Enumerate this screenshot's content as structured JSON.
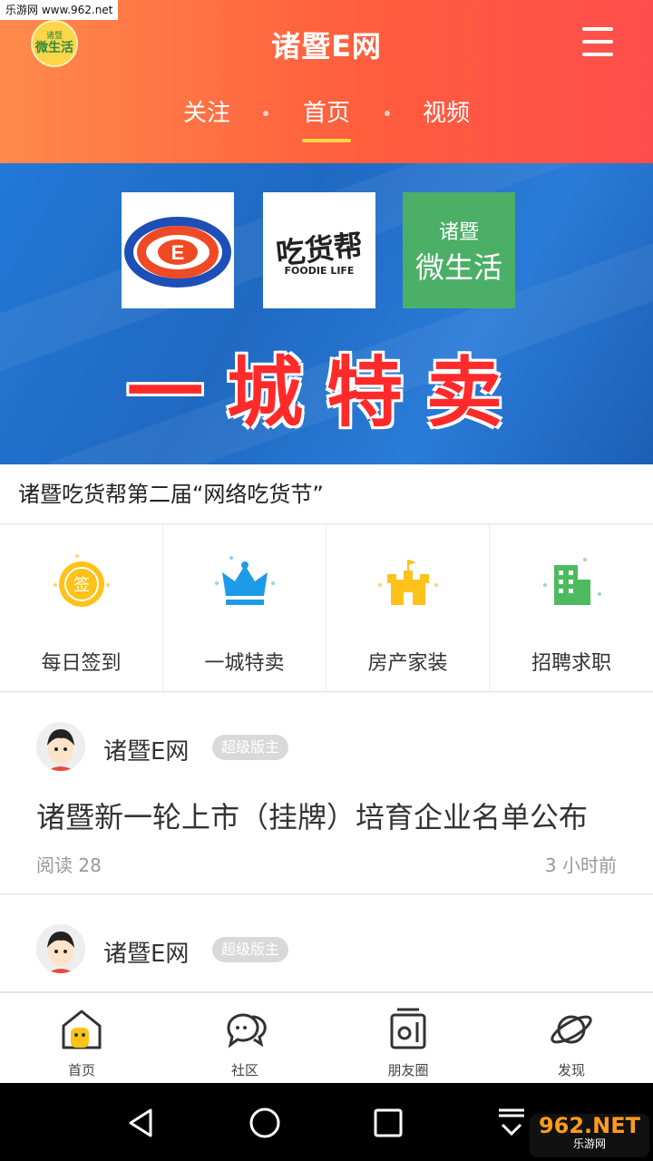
{
  "watermark_top": "乐游网 www.962.net",
  "header": {
    "logo_top": "诸暨",
    "logo_main": "微生活",
    "title": "诸暨E网",
    "tabs": [
      {
        "label": "关注",
        "active": false
      },
      {
        "label": "首页",
        "active": true
      },
      {
        "label": "视频",
        "active": false
      }
    ]
  },
  "banner": {
    "logos": [
      {
        "name": "e-net-logo"
      },
      {
        "name": "foodie-logo",
        "text": "吃货帮",
        "sub": "FOODIE LIFE"
      },
      {
        "name": "wei-life-logo",
        "text_top": "诸暨",
        "text_main": "微生活"
      }
    ],
    "headline": "一城特卖",
    "caption": "诸暨吃货帮第二届“网络吃货节”"
  },
  "quick_links": [
    {
      "label": "每日签到",
      "icon": "sign-in-coin-icon",
      "icon_text": "签"
    },
    {
      "label": "一城特卖",
      "icon": "crown-icon"
    },
    {
      "label": "房产家装",
      "icon": "house-castle-icon"
    },
    {
      "label": "招聘求职",
      "icon": "office-building-icon"
    }
  ],
  "posts": [
    {
      "author": "诸暨E网",
      "badge": "超级版主",
      "title": "诸暨新一轮上市（挂牌）培育企业名单公布",
      "reads": "阅读 28",
      "time": "3 小时前"
    },
    {
      "author": "诸暨E网",
      "badge": "超级版主"
    }
  ],
  "bottom_nav": [
    {
      "label": "首页",
      "icon": "home-icon"
    },
    {
      "label": "社区",
      "icon": "chat-bubbles-icon"
    },
    {
      "label": "朋友圈",
      "icon": "moments-icon"
    },
    {
      "label": "发现",
      "icon": "planet-icon"
    }
  ],
  "watermark_bottom": {
    "main": "962.NET",
    "sub": "乐游网"
  },
  "colors": {
    "header_start": "#ff8a4c",
    "header_end": "#ff4d4d",
    "tab_underline": "#ffd54a",
    "banner_blue": "#1f6fc8",
    "headline_red": "#ff2a2a"
  }
}
